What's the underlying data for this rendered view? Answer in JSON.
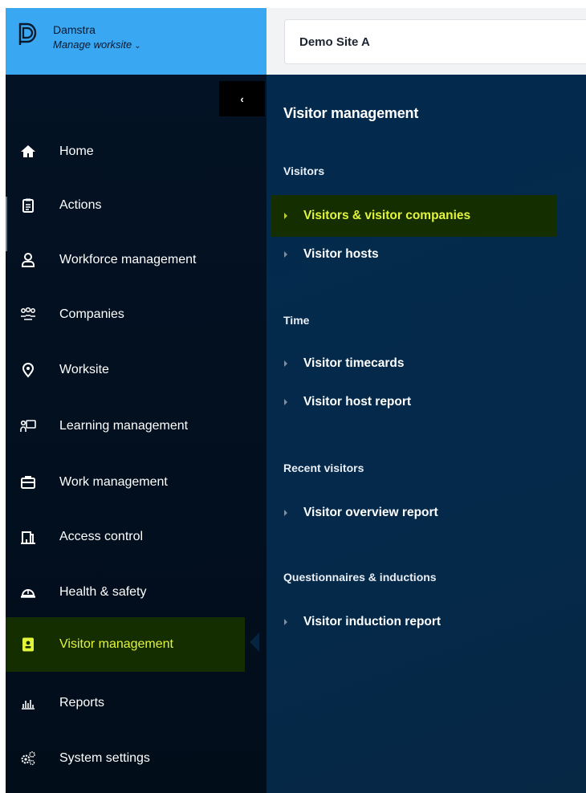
{
  "brand": {
    "name": "Damstra",
    "worksite_link": "Manage worksite",
    "chevron": "⌄"
  },
  "site_selector": {
    "value": "Demo Site A"
  },
  "sidebar": {
    "collapse_glyph": "‹",
    "items": [
      {
        "label": "Home",
        "icon": "home-icon"
      },
      {
        "label": "Actions",
        "icon": "clipboard-icon"
      },
      {
        "label": "Workforce management",
        "icon": "user-icon"
      },
      {
        "label": "Companies",
        "icon": "users-group-icon"
      },
      {
        "label": "Worksite",
        "icon": "location-pin-icon"
      },
      {
        "label": "Learning management",
        "icon": "presentation-icon"
      },
      {
        "label": "Work management",
        "icon": "briefcase-icon"
      },
      {
        "label": "Access control",
        "icon": "building-icon"
      },
      {
        "label": "Health & safety",
        "icon": "hard-hat-icon"
      },
      {
        "label": "Visitor management",
        "icon": "id-badge-icon",
        "active": true
      },
      {
        "label": "Reports",
        "icon": "bar-chart-icon"
      },
      {
        "label": "System settings",
        "icon": "gears-icon"
      }
    ]
  },
  "panel": {
    "title": "Visitor management",
    "sections": [
      {
        "heading": "Visitors",
        "items": [
          "Visitors & visitor companies",
          "Visitor hosts"
        ]
      },
      {
        "heading": "Time",
        "items": [
          "Visitor timecards",
          "Visitor host report"
        ]
      },
      {
        "heading": "Recent visitors",
        "items": [
          "Visitor overview report"
        ]
      },
      {
        "heading": "Questionnaires & inductions",
        "items": [
          "Visitor induction report"
        ]
      }
    ]
  },
  "colors": {
    "brand_blue": "#3aa7f2",
    "sidebar_bg": "#031224",
    "panel_bg": "#032a4d",
    "active_bg": "#142e00",
    "active_text": "#e3f53b"
  }
}
